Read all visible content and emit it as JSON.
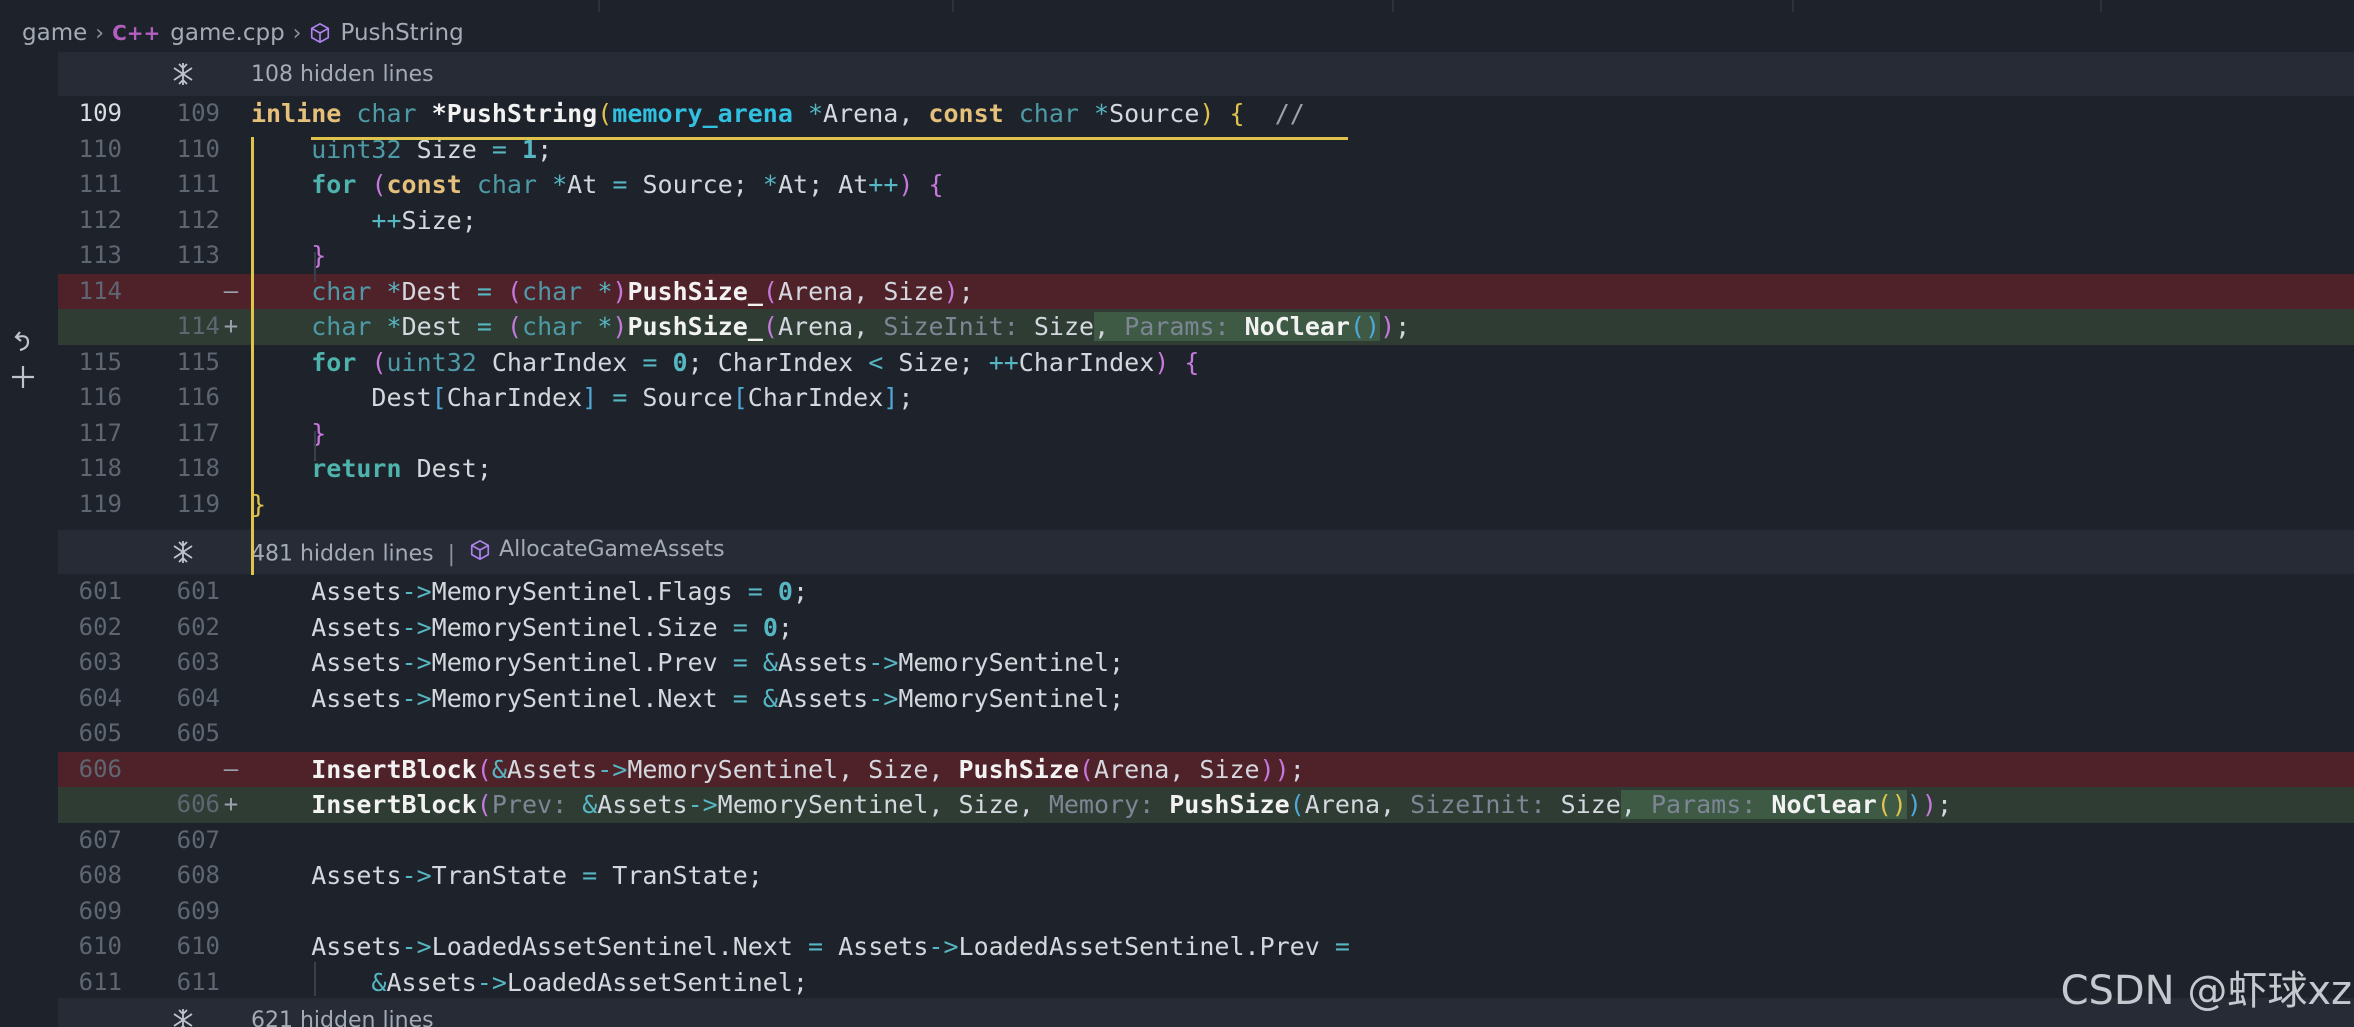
{
  "breadcrumb": {
    "folder": "game",
    "file_icon_label": "C++",
    "file": "game.cpp",
    "symbol": "PushString"
  },
  "folds": [
    {
      "text": "108 hidden lines",
      "symbol": ""
    },
    {
      "text": "481 hidden lines",
      "symbol": "AllocateGameAssets"
    },
    {
      "text": "621 hidden lines",
      "symbol": ""
    }
  ],
  "line_numbers": {
    "block1": [
      {
        "old": "109",
        "new": "109",
        "mark": ""
      },
      {
        "old": "110",
        "new": "110",
        "mark": ""
      },
      {
        "old": "111",
        "new": "111",
        "mark": ""
      },
      {
        "old": "112",
        "new": "112",
        "mark": ""
      },
      {
        "old": "113",
        "new": "113",
        "mark": ""
      },
      {
        "old": "114",
        "new": "",
        "mark": "—"
      },
      {
        "old": "",
        "new": "114",
        "mark": "+"
      },
      {
        "old": "115",
        "new": "115",
        "mark": ""
      },
      {
        "old": "116",
        "new": "116",
        "mark": ""
      },
      {
        "old": "117",
        "new": "117",
        "mark": ""
      },
      {
        "old": "118",
        "new": "118",
        "mark": ""
      },
      {
        "old": "119",
        "new": "119",
        "mark": ""
      }
    ],
    "block2": [
      {
        "old": "601",
        "new": "601",
        "mark": ""
      },
      {
        "old": "602",
        "new": "602",
        "mark": ""
      },
      {
        "old": "603",
        "new": "603",
        "mark": ""
      },
      {
        "old": "604",
        "new": "604",
        "mark": ""
      },
      {
        "old": "605",
        "new": "605",
        "mark": ""
      },
      {
        "old": "606",
        "new": "",
        "mark": "—"
      },
      {
        "old": "",
        "new": "606",
        "mark": "+"
      },
      {
        "old": "607",
        "new": "607",
        "mark": ""
      },
      {
        "old": "608",
        "new": "608",
        "mark": ""
      },
      {
        "old": "609",
        "new": "609",
        "mark": ""
      },
      {
        "old": "610",
        "new": "610",
        "mark": ""
      },
      {
        "old": "611",
        "new": "611",
        "mark": ""
      }
    ]
  },
  "tokens": {
    "inline": "inline",
    "char": "char",
    "star": "*",
    "PushString": "PushString",
    "memory_arena": "memory_arena",
    "Arena": "Arena",
    "const": "const",
    "Source": "Source",
    "comment": "//",
    "uint32": "uint32",
    "Size": "Size",
    "eq": "=",
    "one": "1",
    "zero": "0",
    "semi": ";",
    "for": "for",
    "At": "At",
    "pp": "++",
    "Dest": "Dest",
    "PushSize_": "PushSize_",
    "SizeInit": "SizeInit:",
    "Params": "Params:",
    "NoClear": "NoClear",
    "CharIndex": "CharIndex",
    "lt": "<",
    "return": "return",
    "Assets": "Assets",
    "arrow": "->",
    "MemorySentinel": "MemorySentinel",
    "Flags": "Flags",
    "Prev": "Prev",
    "Next": "Next",
    "amp": "&",
    "InsertBlock": "InsertBlock",
    "PushSize": "PushSize",
    "PrevHint": "Prev:",
    "MemoryHint": "Memory:",
    "TranState": "TranState",
    "LoadedAssetSentinel": "LoadedAssetSentinel"
  },
  "watermark": "CSDN @虾球xz"
}
